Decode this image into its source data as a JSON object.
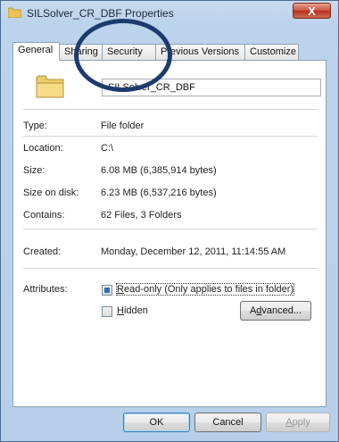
{
  "window": {
    "title": "SILSolver_CR_DBF Properties",
    "close_label": "X"
  },
  "tabs": [
    {
      "label": "General",
      "active": true
    },
    {
      "label": "Sharing",
      "active": false
    },
    {
      "label": "Security",
      "active": false
    },
    {
      "label": "Previous Versions",
      "active": false
    },
    {
      "label": "Customize",
      "active": false
    }
  ],
  "general": {
    "name_value": "SILSolver_CR_DBF",
    "type_label": "Type:",
    "type_value": "File folder",
    "location_label": "Location:",
    "location_value": "C:\\",
    "size_label": "Size:",
    "size_value": "6.08 MB (6,385,914 bytes)",
    "size_on_disk_label": "Size on disk:",
    "size_on_disk_value": "6.23 MB (6,537,216 bytes)",
    "contains_label": "Contains:",
    "contains_value": "62 Files, 3 Folders",
    "created_label": "Created:",
    "created_value": "Monday, December 12, 2011, 11:14:55 AM",
    "attributes_label": "Attributes:",
    "readonly": {
      "mnemonic": "R",
      "rest": "ead-only (Only applies to files in folder)"
    },
    "hidden": {
      "mnemonic": "H",
      "rest": "idden"
    },
    "advanced": {
      "before": "A",
      "mnemonic": "d",
      "after": "vanced..."
    }
  },
  "footer": {
    "ok_label": "OK",
    "cancel_label": "Cancel",
    "apply": {
      "mnemonic": "A",
      "rest": "pply"
    }
  },
  "colors": {
    "frame": "#b7cfe9",
    "accent_circle": "#1e3b6e",
    "checkbox_fill": "#2f6db8",
    "close_button": "#c8513c"
  }
}
